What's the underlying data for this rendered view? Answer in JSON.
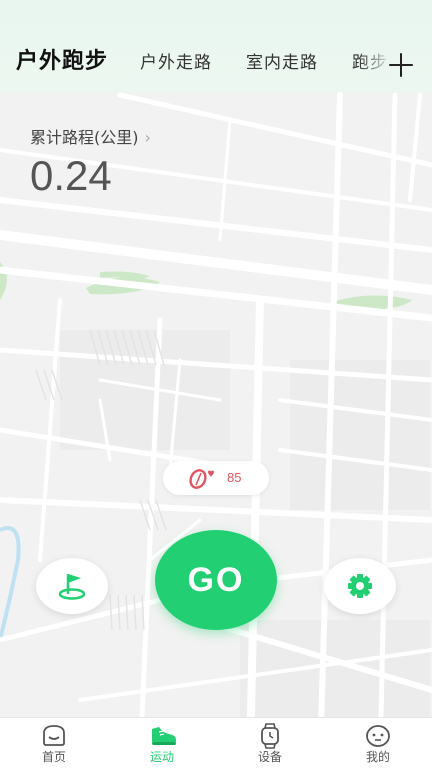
{
  "header": {
    "tabs": [
      {
        "label": "户外跑步",
        "active": true
      },
      {
        "label": "户外走路",
        "active": false
      },
      {
        "label": "室内走路",
        "active": false
      },
      {
        "label": "跑步",
        "active": false
      }
    ],
    "add_icon": "plus-icon"
  },
  "stats": {
    "distance_label": "累计路程(公里)",
    "distance_chevron": "›",
    "distance_value": "0.24"
  },
  "heart_rate": {
    "icon": "heart-rate-band-icon",
    "value": "85",
    "color": "#e0555f"
  },
  "controls": {
    "go_label": "GO",
    "left_icon": "flag-icon",
    "right_icon": "gear-icon",
    "accent": "#22cf72"
  },
  "bottom_nav": {
    "items": [
      {
        "label": "首页",
        "icon": "home-icon",
        "active": false
      },
      {
        "label": "运动",
        "icon": "running-shoe-icon",
        "active": true
      },
      {
        "label": "设备",
        "icon": "watch-icon",
        "active": false
      },
      {
        "label": "我的",
        "icon": "profile-icon",
        "active": false
      }
    ]
  }
}
